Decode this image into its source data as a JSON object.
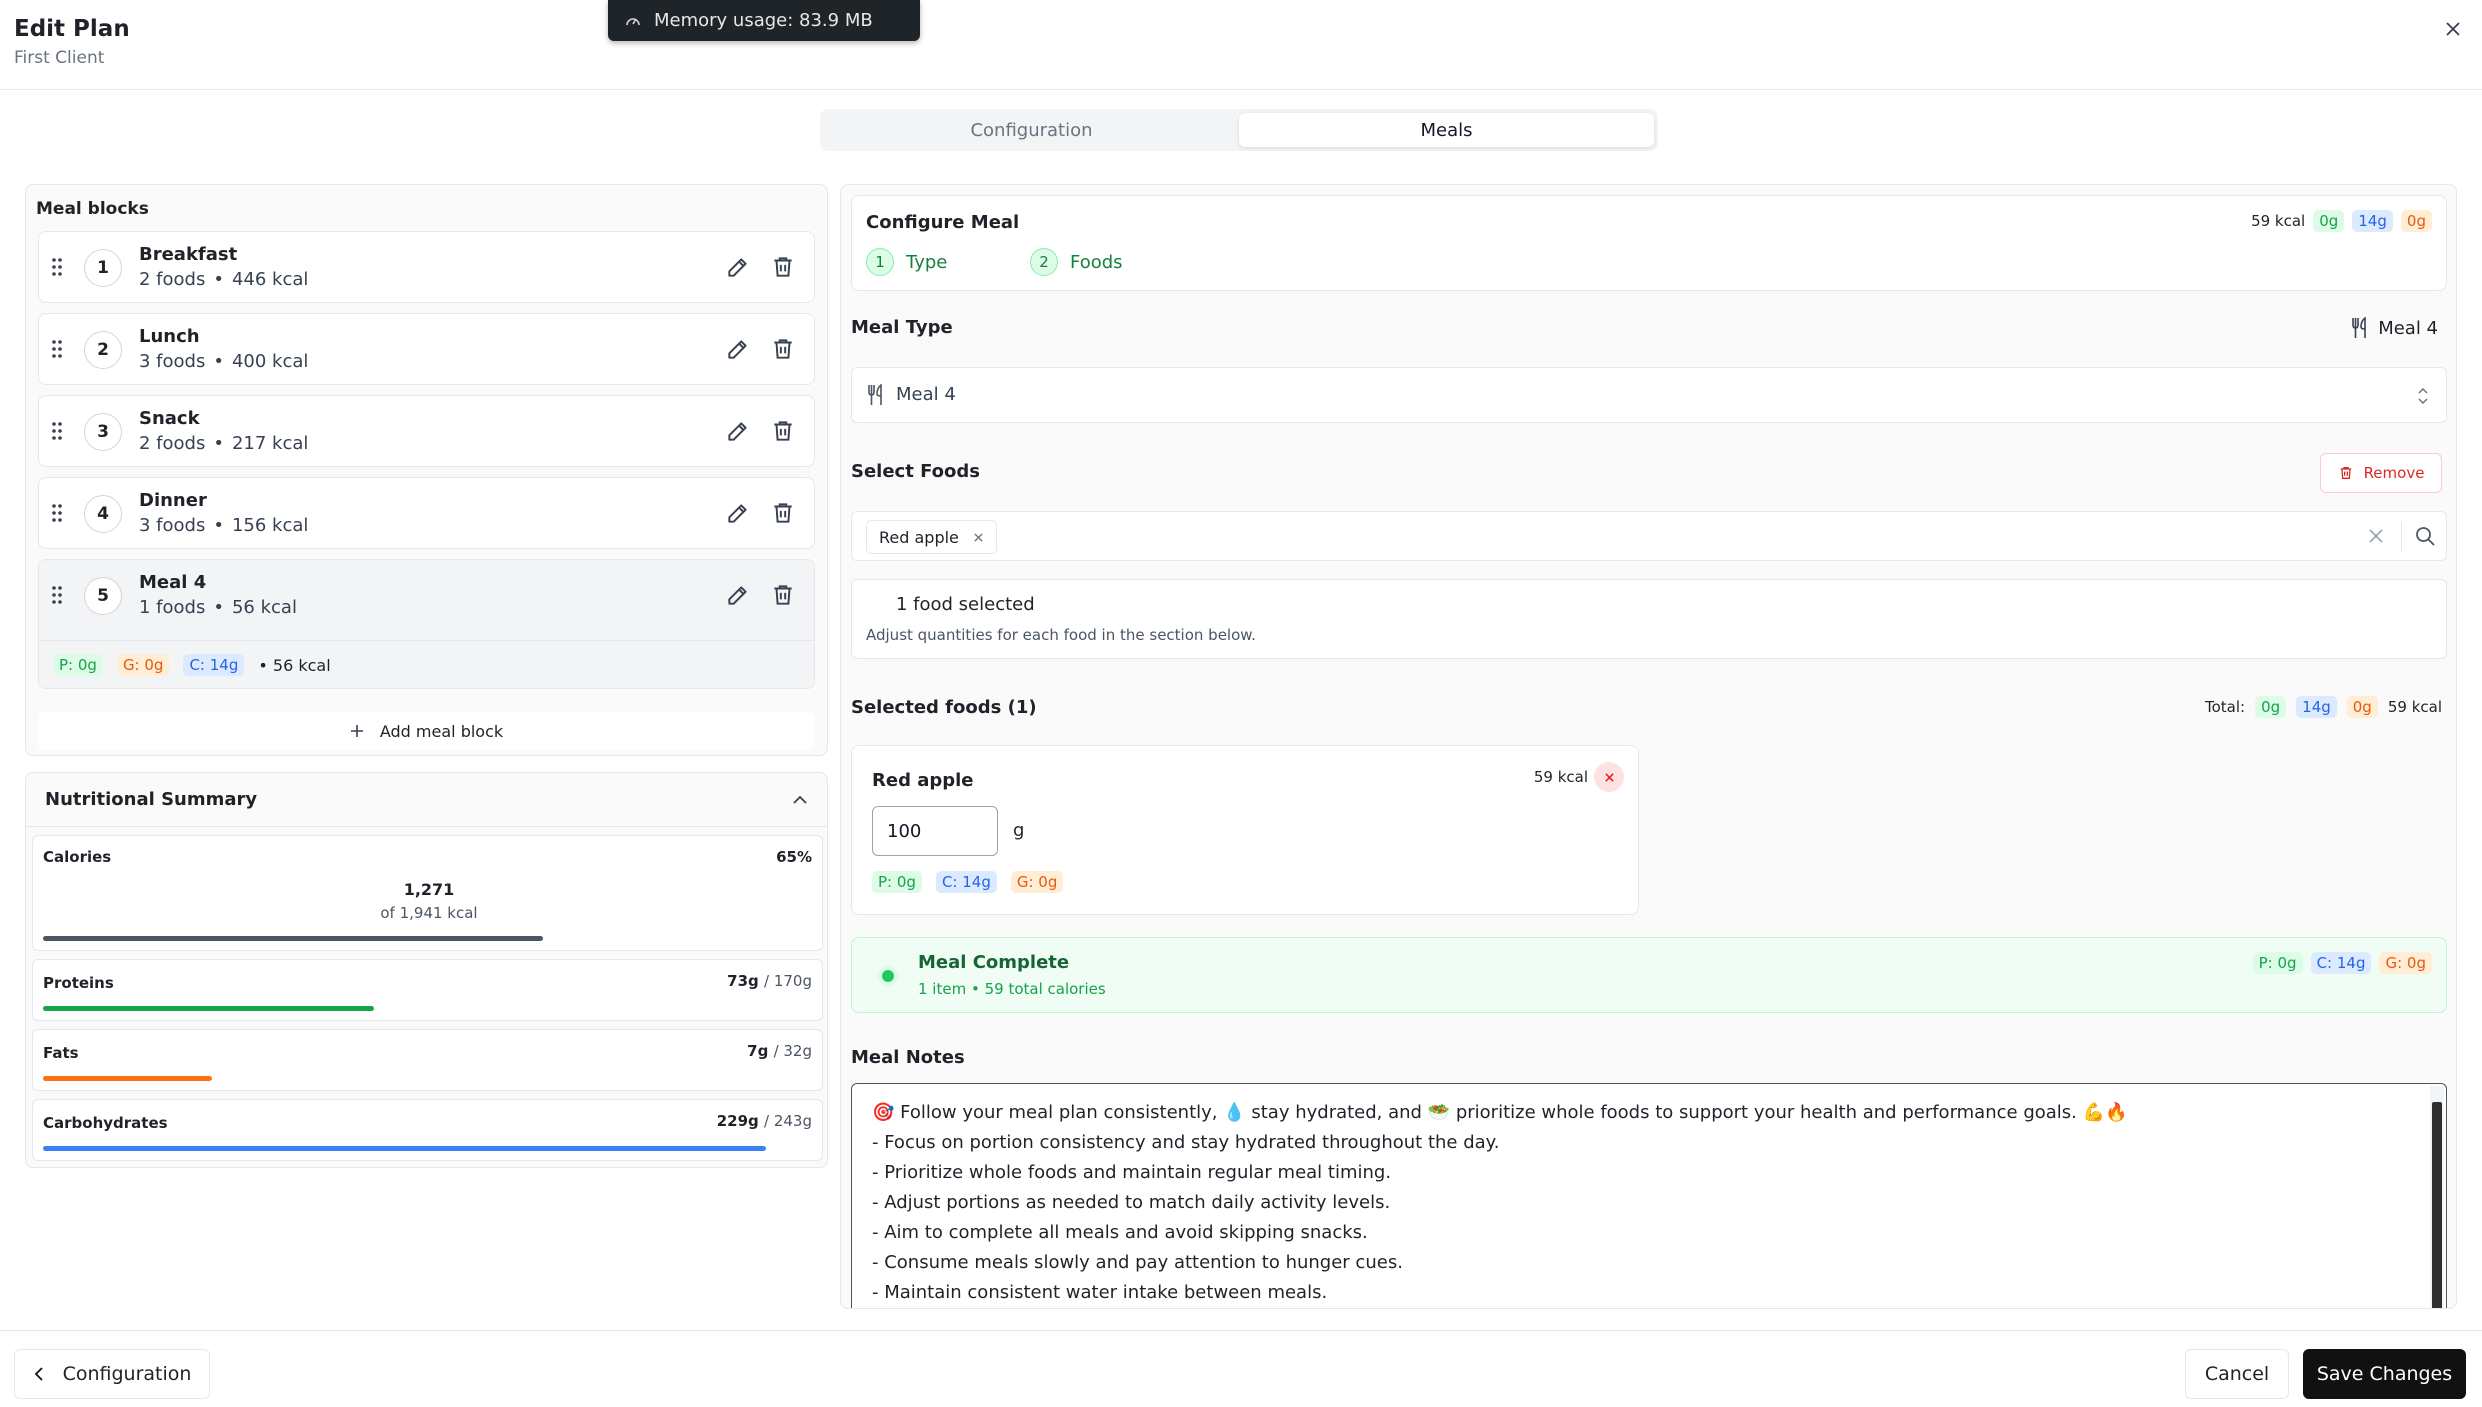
{
  "header": {
    "title": "Edit Plan",
    "subtitle": "First Client"
  },
  "toast": {
    "text": "Memory usage: 83.9 MB",
    "icon": "gauge-icon"
  },
  "tabs": [
    {
      "label": "Configuration",
      "active": false
    },
    {
      "label": "Meals",
      "active": true
    }
  ],
  "meal_blocks": {
    "title": "Meal blocks",
    "items": [
      {
        "num": "1",
        "name": "Breakfast",
        "foods": "2 foods",
        "kcal": "446 kcal"
      },
      {
        "num": "2",
        "name": "Lunch",
        "foods": "3 foods",
        "kcal": "400 kcal"
      },
      {
        "num": "3",
        "name": "Snack",
        "foods": "2 foods",
        "kcal": "217 kcal"
      },
      {
        "num": "4",
        "name": "Dinner",
        "foods": "3 foods",
        "kcal": "156 kcal"
      },
      {
        "num": "5",
        "name": "Meal 4",
        "foods": "1 foods",
        "kcal": "56 kcal"
      }
    ],
    "selected_macros": {
      "p": "P: 0g",
      "g": "G: 0g",
      "c": "C: 14g",
      "kcal": "• 56 kcal"
    },
    "add_label": "Add meal block"
  },
  "nutrition": {
    "title": "Nutritional Summary",
    "calories": {
      "label": "Calories",
      "percent": "65%",
      "value": "1,271",
      "of": "of 1,941 kcal",
      "fraction": 0.65,
      "color": "#4b5563"
    },
    "proteins": {
      "label": "Proteins",
      "value": "73g",
      "target": "/ 170g",
      "fraction": 0.43,
      "color": "#16a34a"
    },
    "fats": {
      "label": "Fats",
      "value": "7g",
      "target": "/ 32g",
      "fraction": 0.22,
      "color": "#f97316"
    },
    "carbs": {
      "label": "Carbohydrates",
      "value": "229g",
      "target": "/ 243g",
      "fraction": 0.94,
      "color": "#3b82f6"
    }
  },
  "configure": {
    "title": "Configure Meal",
    "kcal": "59 kcal",
    "chips": [
      "0g",
      "14g",
      "0g"
    ],
    "steps": [
      {
        "num": "1",
        "label": "Type"
      },
      {
        "num": "2",
        "label": "Foods"
      }
    ]
  },
  "meal_type": {
    "title": "Meal Type",
    "current": "Meal 4",
    "selected": "Meal 4"
  },
  "select_foods": {
    "title": "Select Foods",
    "remove_label": "Remove",
    "tag": "Red apple",
    "info_title": "1 food selected",
    "info_text": "Adjust quantities for each food in the section below."
  },
  "selected_foods": {
    "title": "Selected foods (1)",
    "total_label": "Total:",
    "total_chips": [
      "0g",
      "14g",
      "0g"
    ],
    "total_kcal": "59 kcal",
    "item": {
      "name": "Red apple",
      "kcal": "59 kcal",
      "qty": "100",
      "unit": "g",
      "macros": [
        "P: 0g",
        "C: 14g",
        "G: 0g"
      ]
    }
  },
  "complete": {
    "title": "Meal Complete",
    "text": "1 item • 59 total calories",
    "chips": [
      "P: 0g",
      "C: 14g",
      "G: 0g"
    ]
  },
  "notes": {
    "title": "Meal Notes",
    "lines": [
      "🎯 Follow your meal plan consistently, 💧 stay hydrated, and 🥗 prioritize whole foods to support your health and performance goals. 💪🔥",
      "- Focus on portion consistency and stay hydrated throughout the day.",
      "- Prioritize whole foods and maintain regular meal timing.",
      "- Adjust portions as needed to match daily activity levels.",
      "- Aim to complete all meals and avoid skipping snacks.",
      "- Consume meals slowly and pay attention to hunger cues.",
      "- Maintain consistent water intake between meals."
    ]
  },
  "footer": {
    "back_label": "Configuration",
    "cancel_label": "Cancel",
    "save_label": "Save Changes"
  }
}
